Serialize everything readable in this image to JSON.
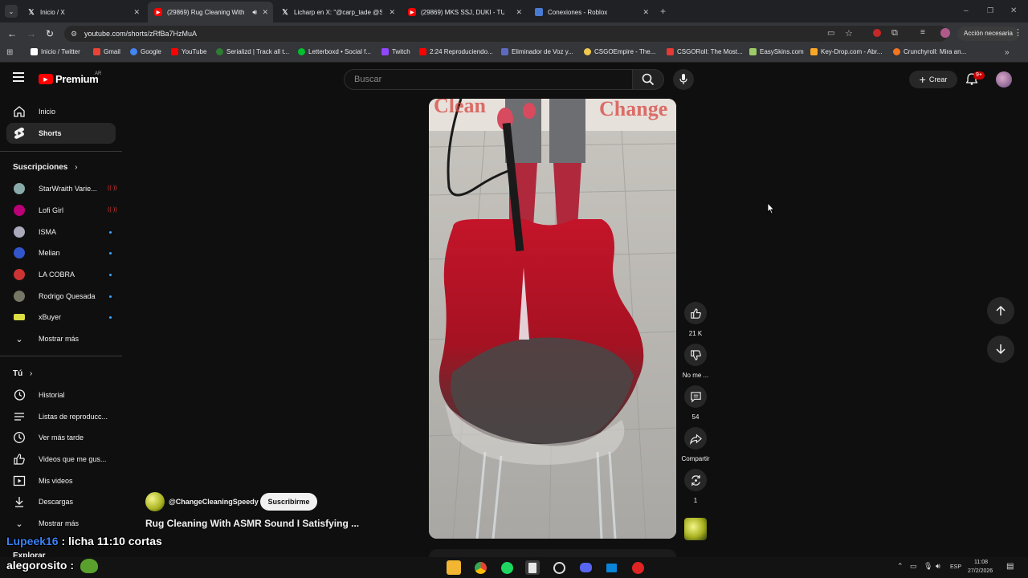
{
  "browser": {
    "tabs": [
      {
        "label": "Inicio / X",
        "icon": "x-logo-icon",
        "active": false
      },
      {
        "label": "(29869) Rug Cleaning With",
        "icon": "youtube-icon",
        "active": true
      },
      {
        "label": "Licharp en X: \"@carp_tade @Sh",
        "icon": "x-logo-icon",
        "active": false
      },
      {
        "label": "(29869) MKS SSJ, DUKI - TU SIL",
        "icon": "youtube-icon",
        "active": false
      },
      {
        "label": "Conexiones - Roblox",
        "icon": "roblox-icon",
        "active": false
      }
    ],
    "url": "youtube.com/shorts/zRfBa7HzMuA",
    "action_required": "Acción necesaria",
    "bookmarks": [
      {
        "label": "Inicio / Twitter",
        "color": "#ffffff"
      },
      {
        "label": "Gmail",
        "color": "#ea4335"
      },
      {
        "label": "Google",
        "color": "#4285f4"
      },
      {
        "label": "YouTube",
        "color": "#ff0000"
      },
      {
        "label": "Serializd | Track all t...",
        "color": "#2e7d32"
      },
      {
        "label": "Letterboxd • Social f...",
        "color": "#00c030"
      },
      {
        "label": "Twitch",
        "color": "#9146ff"
      },
      {
        "label": "2:24 Reproduciendo...",
        "color": "#ff0000"
      },
      {
        "label": "Eliminador de Voz y...",
        "color": "#5c6bc0"
      },
      {
        "label": "CSGOEmpire - The...",
        "color": "#f2c94c"
      },
      {
        "label": "CSGORoll: The Most...",
        "color": "#e53935"
      },
      {
        "label": "EasySkins.com",
        "color": "#9ccc65"
      },
      {
        "label": "Key-Drop.com - Abr...",
        "color": "#f9a825"
      },
      {
        "label": "Crunchyroll: Mira an...",
        "color": "#f47521"
      }
    ]
  },
  "youtube": {
    "logo_text": "Premium",
    "region": "AR",
    "search_placeholder": "Buscar",
    "create_label": "Crear",
    "notifications_badge": "9+",
    "sidebar": {
      "main": [
        {
          "label": "Inicio",
          "icon": "home-icon",
          "selected": false
        },
        {
          "label": "Shorts",
          "icon": "shorts-icon",
          "selected": true
        }
      ],
      "subscriptions_title": "Suscripciones",
      "subscriptions": [
        {
          "label": "StarWraith Varie...",
          "indicator": "live",
          "color": "#8aa"
        },
        {
          "label": "Lofi Girl",
          "indicator": "live",
          "color": "#b07"
        },
        {
          "label": "ISMA",
          "indicator": "dot",
          "color": "#aab"
        },
        {
          "label": "Melian",
          "indicator": "dot",
          "color": "#35c"
        },
        {
          "label": "LA COBRA",
          "indicator": "dot",
          "color": "#c33"
        },
        {
          "label": "Rodrigo Quesada",
          "indicator": "dot",
          "color": "#776"
        },
        {
          "label": "xBuyer",
          "indicator": "dot",
          "color": "#dd4"
        }
      ],
      "show_more": "Mostrar más",
      "you_title": "Tú",
      "you_items": [
        {
          "label": "Historial",
          "icon": "history-icon"
        },
        {
          "label": "Listas de reproducc...",
          "icon": "playlists-icon"
        },
        {
          "label": "Ver más tarde",
          "icon": "watch-later-icon"
        },
        {
          "label": "Videos que me gus...",
          "icon": "like-icon"
        },
        {
          "label": "Mis videos",
          "icon": "my-videos-icon"
        },
        {
          "label": "Descargas",
          "icon": "download-icon"
        },
        {
          "label": "Mostrar más",
          "icon": "chevron-down-icon"
        }
      ],
      "explore_title": "Explorar"
    },
    "short": {
      "channel": "@ChangeCleaningSpeedy",
      "subscribe_label": "Suscribirme",
      "title": "Rug Cleaning With ASMR Sound I Satisfying ...",
      "video_sign_text_1": "Clean",
      "video_sign_text_2": "Change"
    },
    "actions": {
      "likes": "21 K",
      "dislike_label": "No me ...",
      "comments": "54",
      "share_label": "Compartir",
      "remix_count": "1"
    }
  },
  "overlay_chat": [
    {
      "user": "Lupeek16",
      "user_color": "#3b82f6",
      "message": ": licha 11:10 cortas"
    },
    {
      "user": "alegorosito",
      "user_color": "#ffffff",
      "message": ":"
    }
  ],
  "taskbar": {
    "language": "ESP",
    "time": "11:08",
    "date": "27/2/2026"
  }
}
